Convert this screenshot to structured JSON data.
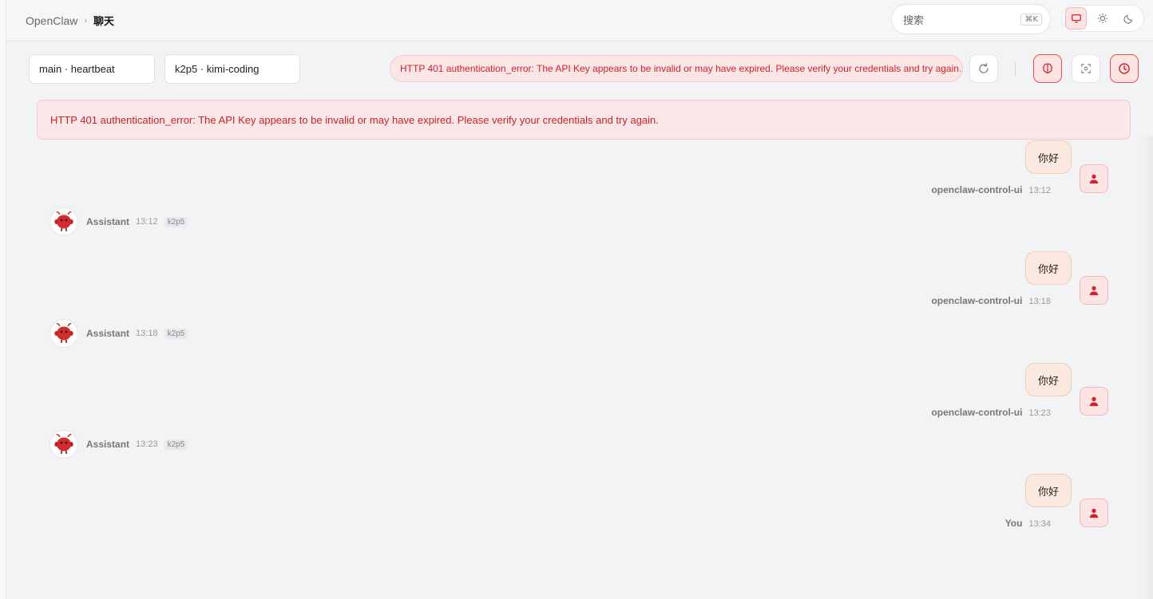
{
  "header": {
    "breadcrumb_root": "OpenClaw",
    "breadcrumb_sep": "›",
    "breadcrumb_current": "聊天",
    "search_placeholder": "搜索",
    "search_shortcut": "⌘K"
  },
  "toolbar": {
    "session_select": "main · heartbeat",
    "model_select": "k2p5 · kimi-coding",
    "error_text": "HTTP 401 authentication_error: The API Key appears to be invalid or may have expired. Please verify your credentials and try again."
  },
  "banner": {
    "text": "HTTP 401 authentication_error: The API Key appears to be invalid or may have expired. Please verify your credentials and try again."
  },
  "messages": [
    {
      "role": "user",
      "text": "你好",
      "sender": "openclaw-control-ui",
      "time": "13:12"
    },
    {
      "role": "assistant",
      "sender": "Assistant",
      "time": "13:12",
      "model": "k2p5"
    },
    {
      "role": "user",
      "text": "你好",
      "sender": "openclaw-control-ui",
      "time": "13:18"
    },
    {
      "role": "assistant",
      "sender": "Assistant",
      "time": "13:18",
      "model": "k2p5"
    },
    {
      "role": "user",
      "text": "你好",
      "sender": "openclaw-control-ui",
      "time": "13:23"
    },
    {
      "role": "assistant",
      "sender": "Assistant",
      "time": "13:23",
      "model": "k2p5"
    },
    {
      "role": "user",
      "text": "你好",
      "sender": "You",
      "time": "13:34"
    }
  ],
  "icons": {
    "theme_system": "monitor-icon",
    "theme_light": "sun-icon",
    "theme_dark": "moon-icon",
    "refresh": "refresh-icon",
    "thinking": "brain-icon",
    "focus": "focus-icon",
    "history": "clock-icon",
    "user_avatar": "user-icon",
    "bot_avatar": "lobster-icon"
  },
  "colors": {
    "accent": "#d0222a",
    "accent_bg": "#fde4e4",
    "bubble_bg": "#fbe9e0",
    "page_bg": "#f2f3f5"
  }
}
